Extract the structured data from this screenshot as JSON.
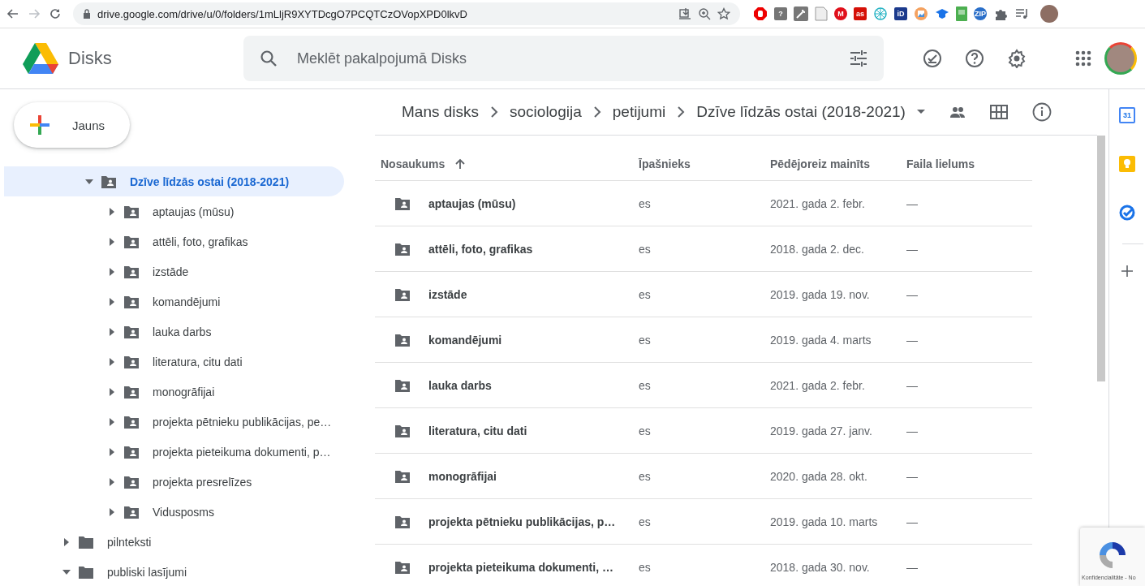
{
  "browser": {
    "url": "drive.google.com/drive/u/0/folders/1mLljR9XYTDcgO7PCQTCzOVopXPD0lkvD",
    "extensions": [
      {
        "kind": "stop"
      },
      {
        "kind": "badge",
        "label": "?",
        "color": "#757575",
        "round": false
      },
      {
        "kind": "wrench"
      },
      {
        "kind": "page"
      },
      {
        "kind": "badge",
        "label": "M",
        "color": "#e0101b",
        "round": true
      },
      {
        "kind": "badge",
        "label": "as",
        "color": "#d51007",
        "round": false
      },
      {
        "kind": "web"
      },
      {
        "kind": "badge",
        "label": "iD",
        "color": "#1b3a8c",
        "round": false
      },
      {
        "kind": "picture"
      },
      {
        "kind": "cap"
      },
      {
        "kind": "book"
      },
      {
        "kind": "badge",
        "label": "ZIP",
        "color": "#2a6fc9",
        "round": true
      },
      {
        "kind": "puzzle"
      },
      {
        "kind": "playlist"
      }
    ]
  },
  "app": {
    "name": "Disks",
    "search": {
      "placeholder": "Meklēt pakalpojumā Disks"
    }
  },
  "new_button": "Jauns",
  "tree": [
    {
      "children": [
        {
          "label": "Dzīve līdzās ostai (2018-2021)",
          "shared": true,
          "expanded": true,
          "selected": true,
          "children": [
            {
              "label": "aptaujas (mūsu)",
              "shared": true,
              "expanded": false,
              "selected": false
            },
            {
              "label": "attēli, foto, grafikas",
              "shared": true,
              "expanded": false,
              "selected": false
            },
            {
              "label": "izstāde",
              "shared": true,
              "expanded": false,
              "selected": false
            },
            {
              "label": "komandējumi",
              "shared": true,
              "expanded": false,
              "selected": false
            },
            {
              "label": "lauka darbs",
              "shared": true,
              "expanded": false,
              "selected": false
            },
            {
              "label": "literatura, citu dati",
              "shared": true,
              "expanded": false,
              "selected": false
            },
            {
              "label": "monogrāfijai",
              "shared": true,
              "expanded": false,
              "selected": false
            },
            {
              "label": "projekta pētnieku publikācijas, pe…",
              "shared": true,
              "expanded": false,
              "selected": false
            },
            {
              "label": "projekta pieteikuma dokumenti, p…",
              "shared": true,
              "expanded": false,
              "selected": false
            },
            {
              "label": "projekta presrelīzes",
              "shared": true,
              "expanded": false,
              "selected": false
            },
            {
              "label": "Vidusposms",
              "shared": true,
              "expanded": false,
              "selected": false
            }
          ]
        }
      ]
    },
    {
      "label": "pilnteksti",
      "shared": false,
      "expanded": false,
      "selected": false
    },
    {
      "label": "publiski lasījumi",
      "shared": false,
      "expanded": true,
      "selected": false
    }
  ],
  "breadcrumbs": [
    "Mans disks",
    "sociologija",
    "petijumi",
    "Dzīve līdzās ostai (2018-2021)"
  ],
  "table": {
    "columns": [
      {
        "label": "Nosaukums",
        "sorted": true
      },
      {
        "label": "Īpašnieks",
        "sorted": false
      },
      {
        "label": "Pēdējoreiz mainīts",
        "sorted": false
      },
      {
        "label": "Faila lielums",
        "sorted": false
      }
    ],
    "rows": [
      {
        "name": "aptaujas (mūsu)",
        "owner": "es",
        "modified": "2021. gada 2. febr.",
        "size": "—"
      },
      {
        "name": "attēli, foto, grafikas",
        "owner": "es",
        "modified": "2018. gada 2. dec.",
        "size": "—"
      },
      {
        "name": "izstāde",
        "owner": "es",
        "modified": "2019. gada 19. nov.",
        "size": "—"
      },
      {
        "name": "komandējumi",
        "owner": "es",
        "modified": "2019. gada 4. marts",
        "size": "—"
      },
      {
        "name": "lauka darbs",
        "owner": "es",
        "modified": "2021. gada 2. febr.",
        "size": "—"
      },
      {
        "name": "literatura, citu dati",
        "owner": "es",
        "modified": "2019. gada 27. janv.",
        "size": "—"
      },
      {
        "name": "monogrāfijai",
        "owner": "es",
        "modified": "2020. gada 28. okt.",
        "size": "—"
      },
      {
        "name": "projekta pētnieku publikācijas, p…",
        "owner": "es",
        "modified": "2019. gada 10. marts",
        "size": "—"
      },
      {
        "name": "projekta pieteikuma dokumenti, …",
        "owner": "es",
        "modified": "2018. gada 30. nov.",
        "size": "—"
      }
    ]
  },
  "side_panel": [
    {
      "kind": "calendar",
      "label": "31"
    },
    {
      "kind": "keep"
    },
    {
      "kind": "tasks"
    },
    {
      "kind": "add"
    }
  ],
  "recaptcha": {
    "text": "Konfidencialitāte - No"
  }
}
